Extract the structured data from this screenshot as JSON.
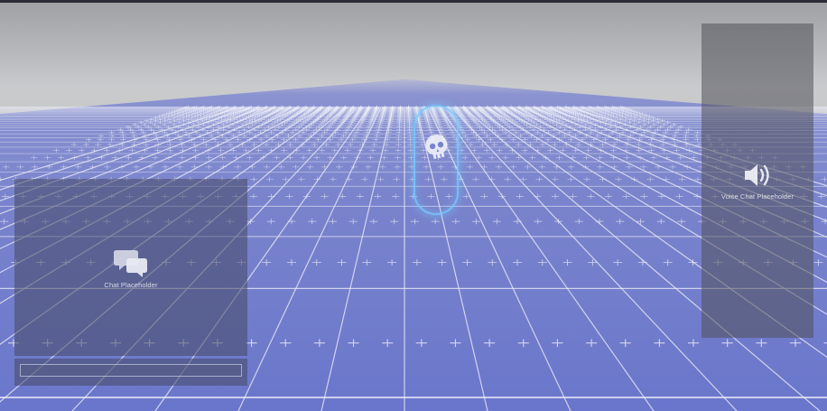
{
  "hud": {
    "chat": {
      "placeholder_label": "Chat Placeholder",
      "icon": "chat-bubbles-icon",
      "input_value": ""
    },
    "voice_chat": {
      "placeholder_label": "Voice Chat Placeholder",
      "icon": "speaker-icon"
    }
  },
  "scene": {
    "player_icon": "skull-icon",
    "colors": {
      "floor": "#6d79c9",
      "floor_far": "#8b93cf",
      "grid_line": "#e8eaf6",
      "sky": "#c8c9cb",
      "capsule_outline": "#7dc8ff"
    }
  }
}
